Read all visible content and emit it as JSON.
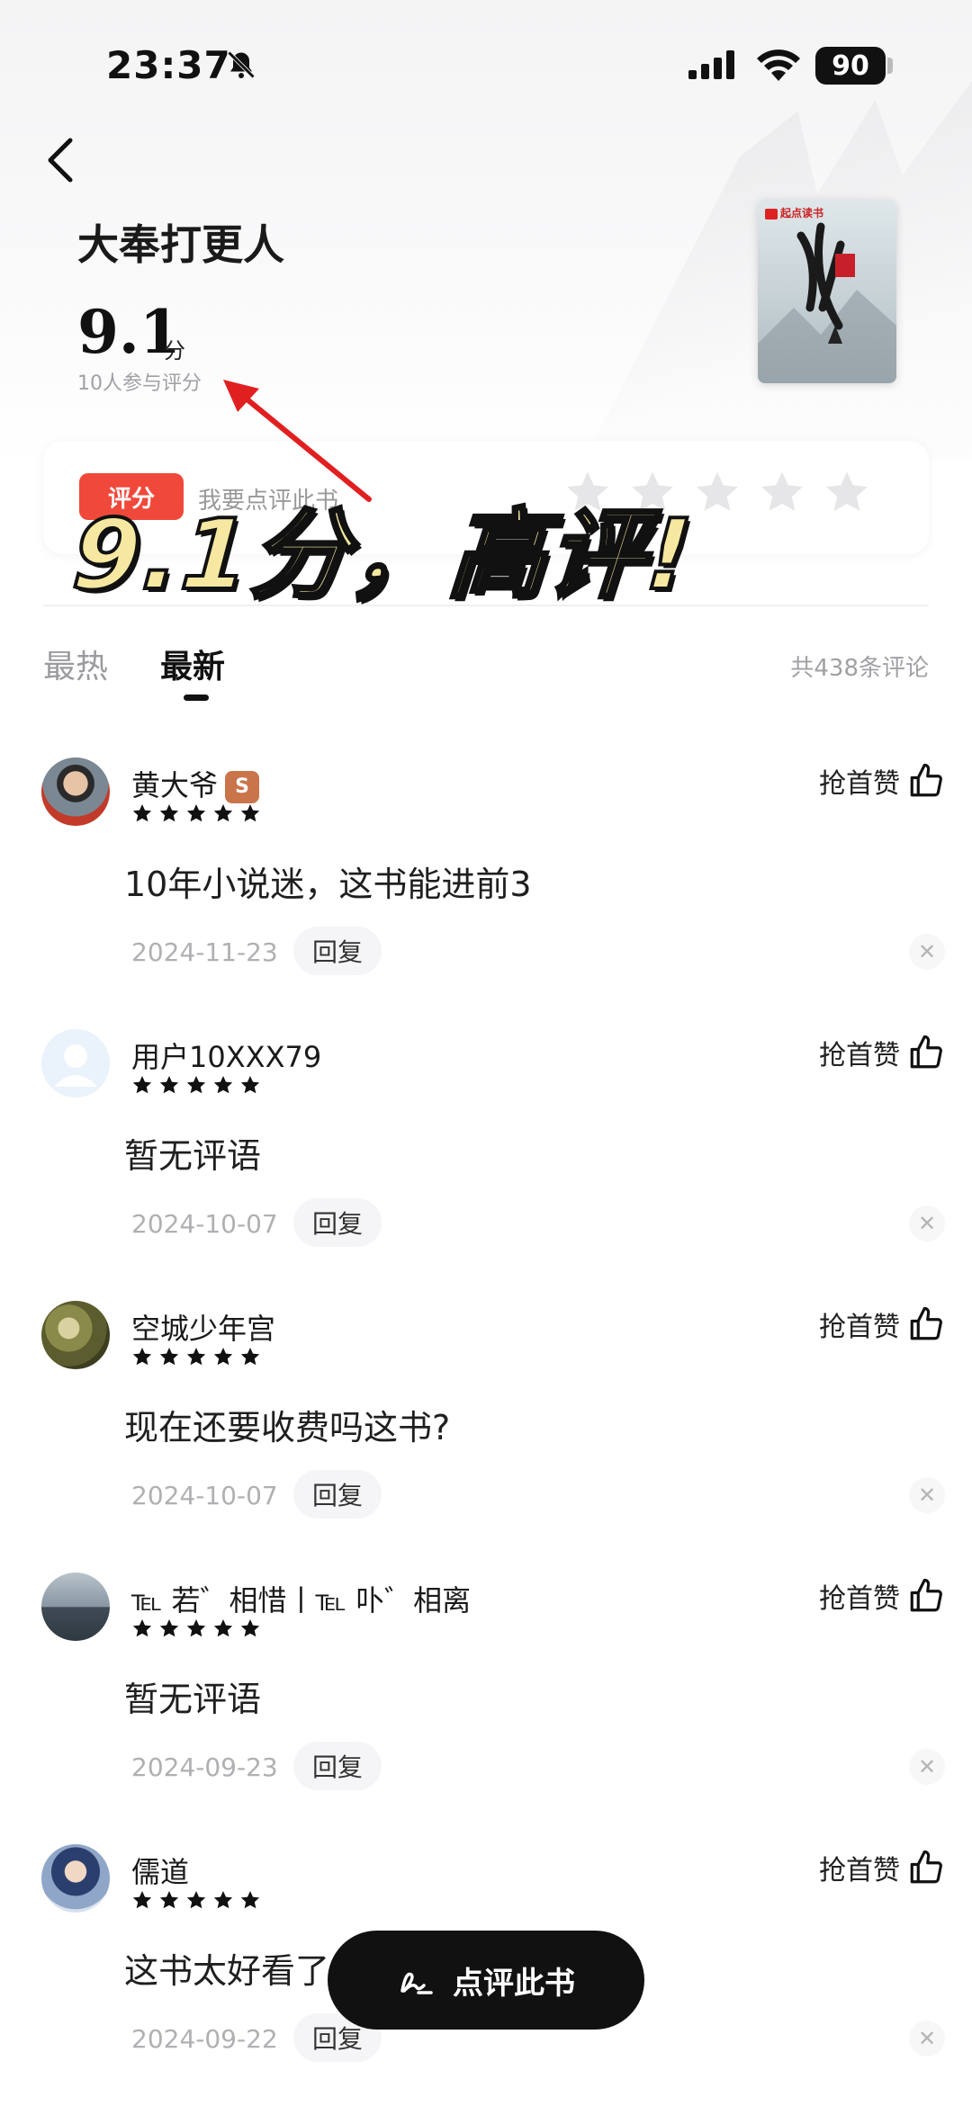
{
  "status_bar": {
    "time": "23:37",
    "battery": "90"
  },
  "book": {
    "title": "大奉打更人",
    "score": "9.1",
    "score_unit": "分",
    "participants": "10人参与评分",
    "cover_brand": "起点读书"
  },
  "my_rating": {
    "badge": "评分",
    "hint": "我要点评此书"
  },
  "annotation": {
    "overlay_text": "9.1分，高评!"
  },
  "tabs": {
    "hot": "最热",
    "new": "最新",
    "active": "最新"
  },
  "total_comments": "共438条评论",
  "comments": [
    {
      "user": "黄大爷",
      "badge": "S",
      "text": "10年小说迷，这书能进前3",
      "date": "2024-11-23",
      "like_label": "抢首赞",
      "reply": "回复",
      "stars": 5
    },
    {
      "user": "用户10XXX79",
      "text": "暂无评语",
      "date": "2024-10-07",
      "like_label": "抢首赞",
      "reply": "回复",
      "stars": 5
    },
    {
      "user": "空城少年宫",
      "text": "现在还要收费吗这书?",
      "date": "2024-10-07",
      "like_label": "抢首赞",
      "reply": "回复",
      "stars": 5
    },
    {
      "user": "℡ 若゛相惜丨℡ 卟゛相离",
      "text": "暂无评语",
      "date": "2024-09-23",
      "like_label": "抢首赞",
      "reply": "回复",
      "stars": 5
    },
    {
      "user": "儒道",
      "text": "这书太好看了",
      "date": "2024-09-22",
      "like_label": "抢首赞",
      "reply": "回复",
      "stars": 5
    }
  ],
  "review_button": {
    "label": "点评此书"
  },
  "colors": {
    "accent_red": "#f0483a",
    "overlay_yellow": "#f6e8a0",
    "button_black": "#111111"
  }
}
